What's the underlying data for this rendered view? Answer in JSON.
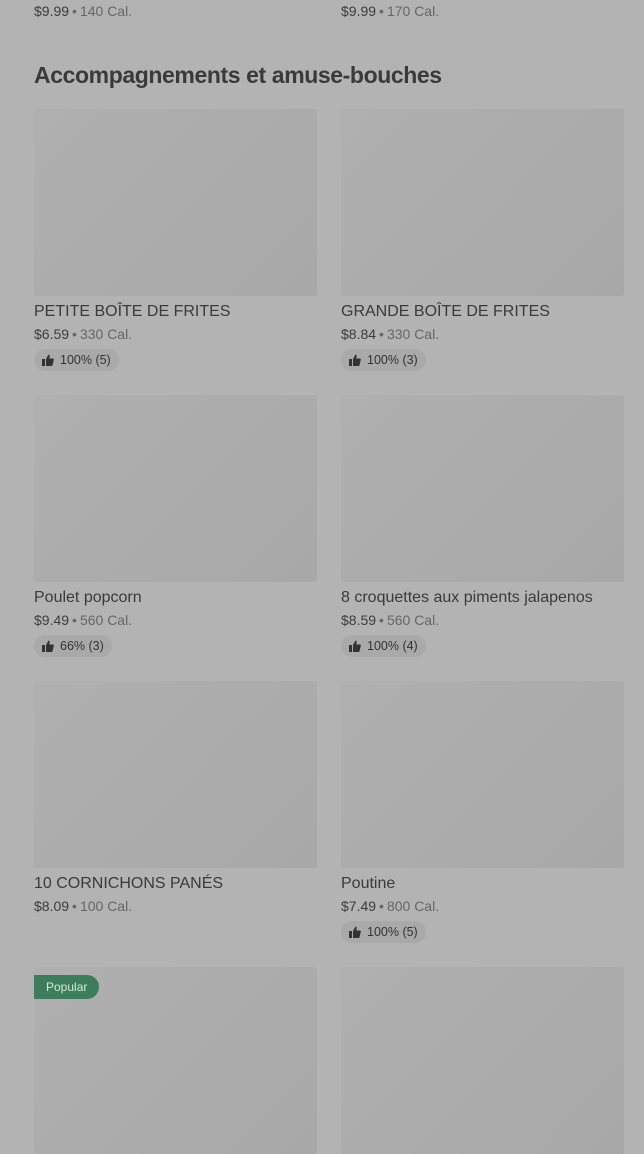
{
  "top_row": {
    "left": {
      "price": "$9.99",
      "cal": "140 Cal."
    },
    "right": {
      "price": "$9.99",
      "cal": "170 Cal."
    }
  },
  "separator": "•",
  "section": {
    "title": "Accompagnements et amuse-bouches"
  },
  "items": [
    {
      "name": "PETITE BOÎTE DE FRITES",
      "price": "$6.59",
      "cal": "330 Cal.",
      "rating": "100% (5)"
    },
    {
      "name": "GRANDE BOÎTE DE FRITES",
      "price": "$8.84",
      "cal": "330 Cal.",
      "rating": "100% (3)"
    },
    {
      "name": "Poulet popcorn",
      "price": "$9.49",
      "cal": "560 Cal.",
      "rating": "66% (3)"
    },
    {
      "name": "8 croquettes aux piments jalapenos",
      "price": "$8.59",
      "cal": "560 Cal.",
      "rating": "100% (4)"
    },
    {
      "name": "10 CORNICHONS PANÉS",
      "price": "$8.09",
      "cal": "100 Cal.",
      "rating": ""
    },
    {
      "name": "Poutine",
      "price": "$7.49",
      "cal": "800 Cal.",
      "rating": "100% (5)"
    },
    {
      "badge": "Popular"
    },
    {}
  ],
  "colors": {
    "background": "#b3b3b3",
    "badge": "#3d7d5c",
    "rating_pill": "#a9a9a9"
  }
}
